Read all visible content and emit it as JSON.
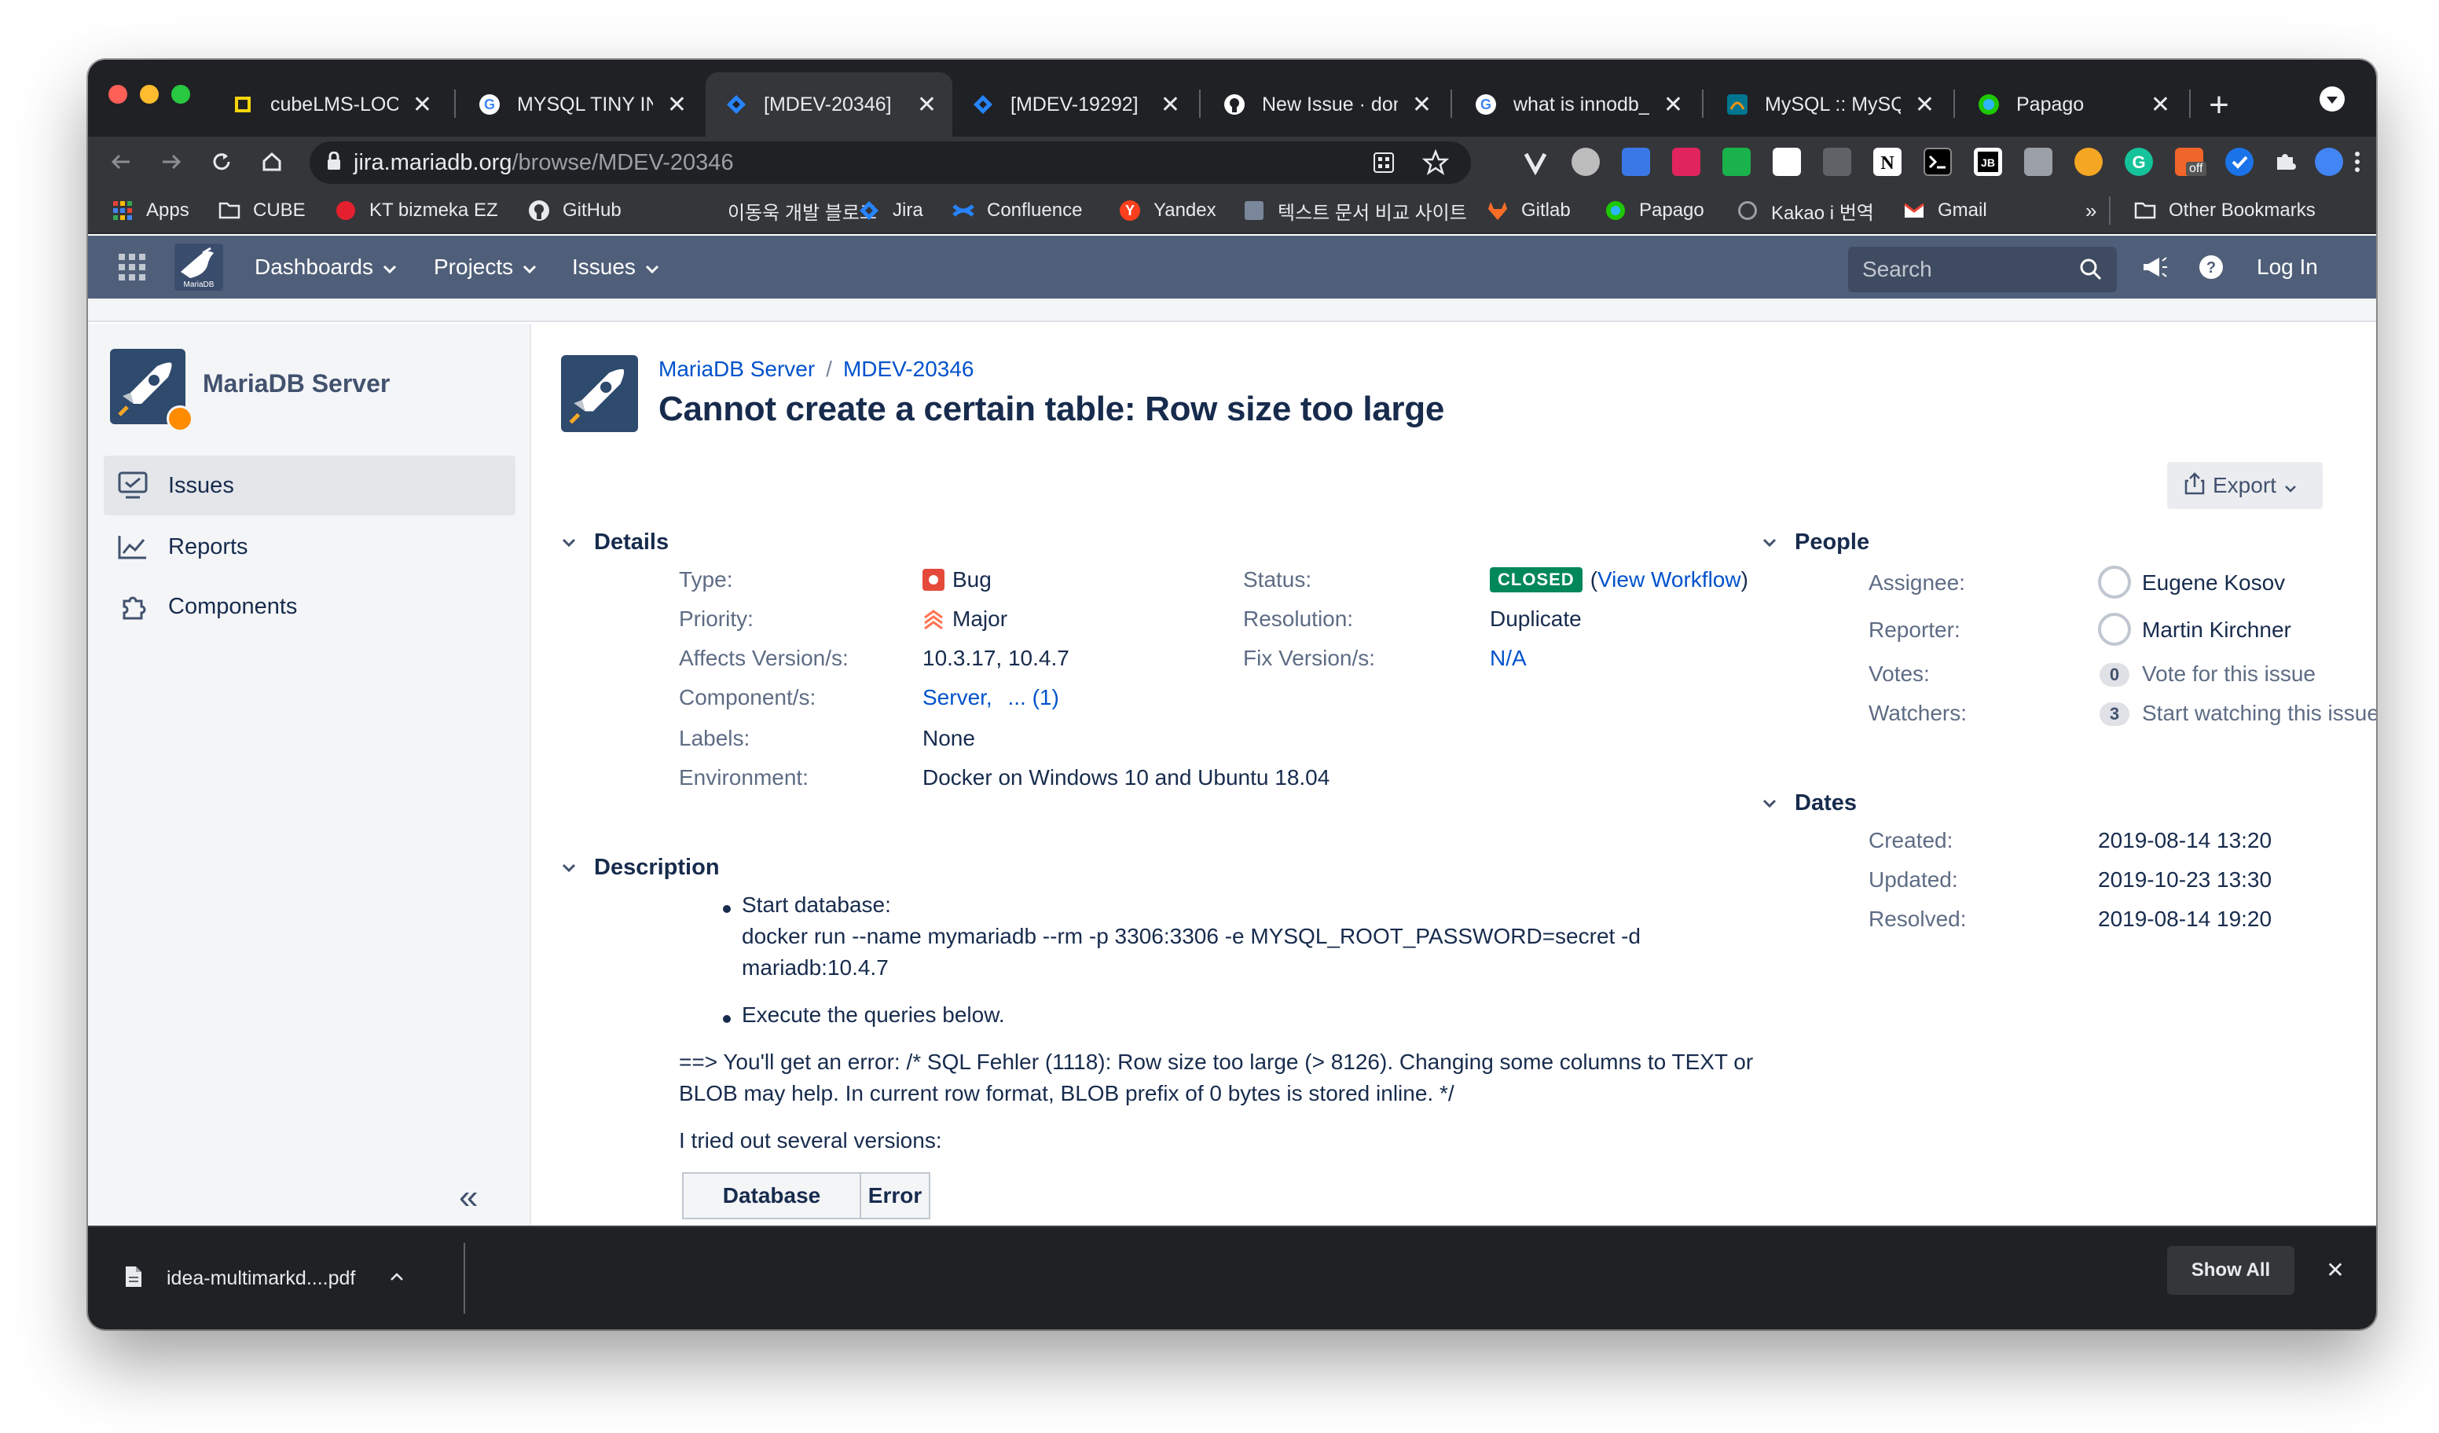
{
  "browser": {
    "tabs": [
      {
        "title": "cubeLMS-LOCA",
        "close": "✕",
        "active": false
      },
      {
        "title": "MYSQL TINY IN",
        "close": "✕",
        "active": false
      },
      {
        "title": "[MDEV-20346]",
        "close": "✕",
        "active": true
      },
      {
        "title": "[MDEV-19292]",
        "close": "✕",
        "active": false
      },
      {
        "title": "New Issue · don",
        "close": "✕",
        "active": false
      },
      {
        "title": "what is innodb_",
        "close": "✕",
        "active": false
      },
      {
        "title": "MySQL :: MySQ",
        "close": "✕",
        "active": false
      },
      {
        "title": "Papago",
        "close": "✕",
        "active": false
      }
    ],
    "new_tab": "+",
    "url_host": "jira.mariadb.org",
    "url_path": "/browse/MDEV-20346",
    "bookmarks": [
      "Apps",
      "CUBE",
      "KT bizmeka EZ",
      "GitHub",
      "이동욱 개발 블로그",
      "Jira",
      "Confluence",
      "Yandex",
      "텍스트 문서 비교 사이트",
      "Gitlab",
      "Papago",
      "Kakao i 번역",
      "Gmail"
    ],
    "bookmarks_overflow": "»",
    "other_bookmarks": "Other Bookmarks",
    "extension_off_badge": "off"
  },
  "jira_header": {
    "nav": [
      "Dashboards",
      "Projects",
      "Issues"
    ],
    "search_placeholder": "Search",
    "login": "Log In",
    "logo_text": "MariaDB"
  },
  "sidebar": {
    "project_name": "MariaDB Server",
    "items": [
      {
        "label": "Issues",
        "icon": "issues-icon",
        "selected": true
      },
      {
        "label": "Reports",
        "icon": "reports-icon",
        "selected": false
      },
      {
        "label": "Components",
        "icon": "components-icon",
        "selected": false
      }
    ],
    "collapse_label": "«"
  },
  "issue": {
    "breadcrumb_project": "MariaDB Server",
    "breadcrumb_sep": "/",
    "breadcrumb_key": "MDEV-20346",
    "title": "Cannot create a certain table: Row size too large",
    "export_label": "Export",
    "details_heading": "Details",
    "type_label": "Type:",
    "type_value": "Bug",
    "priority_label": "Priority:",
    "priority_value": "Major",
    "affects_label": "Affects Version/s:",
    "affects_value": "10.3.17, 10.4.7",
    "component_label": "Component/s:",
    "component_value": "Server,",
    "component_more": "... (1)",
    "labels_label": "Labels:",
    "labels_value": "None",
    "environment_label": "Environment:",
    "environment_value": "Docker on Windows 10 and Ubuntu 18.04",
    "status_label": "Status:",
    "status_value": "CLOSED",
    "status_link_open": "(",
    "status_link": "View Workflow",
    "status_link_close": ")",
    "resolution_label": "Resolution:",
    "resolution_value": "Duplicate",
    "fix_label": "Fix Version/s:",
    "fix_value": "N/A",
    "description_heading": "Description",
    "desc_bullet1_line1": "Start database:",
    "desc_bullet1_line2": "docker run --name mymariadb --rm -p 3306:3306 -e MYSQL_ROOT_PASSWORD=secret -d",
    "desc_bullet1_line3": "mariadb:10.4.7",
    "desc_bullet2": "Execute the queries below.",
    "desc_para1_line1": "==> You'll get an error: /* SQL Fehler (1118): Row size too large (> 8126). Changing some columns to TEXT or",
    "desc_para1_line2": "BLOB may help. In current row format, BLOB prefix of 0 bytes is stored inline. */",
    "desc_para2": "I tried out several versions:",
    "table_headers": [
      "Database",
      "Error"
    ]
  },
  "people": {
    "heading": "People",
    "assignee_label": "Assignee:",
    "assignee": "Eugene Kosov",
    "reporter_label": "Reporter:",
    "reporter": "Martin Kirchner",
    "votes_label": "Votes:",
    "votes_count": "0",
    "votes_link": "Vote for this issue",
    "watchers_label": "Watchers:",
    "watchers_count": "3",
    "watchers_link": "Start watching this issue"
  },
  "dates": {
    "heading": "Dates",
    "created_label": "Created:",
    "created": "2019-08-14 13:20",
    "updated_label": "Updated:",
    "updated": "2019-10-23 13:30",
    "resolved_label": "Resolved:",
    "resolved": "2019-08-14 19:20"
  },
  "downloads": {
    "file_name": "idea-multimarkd....pdf",
    "show_all": "Show All",
    "close": "✕"
  },
  "colors": {
    "jira_header": "#505f79",
    "link": "#0052cc",
    "status_closed": "#00875a",
    "bug_red": "#e5493a",
    "priority_orange": "#ff7452"
  }
}
